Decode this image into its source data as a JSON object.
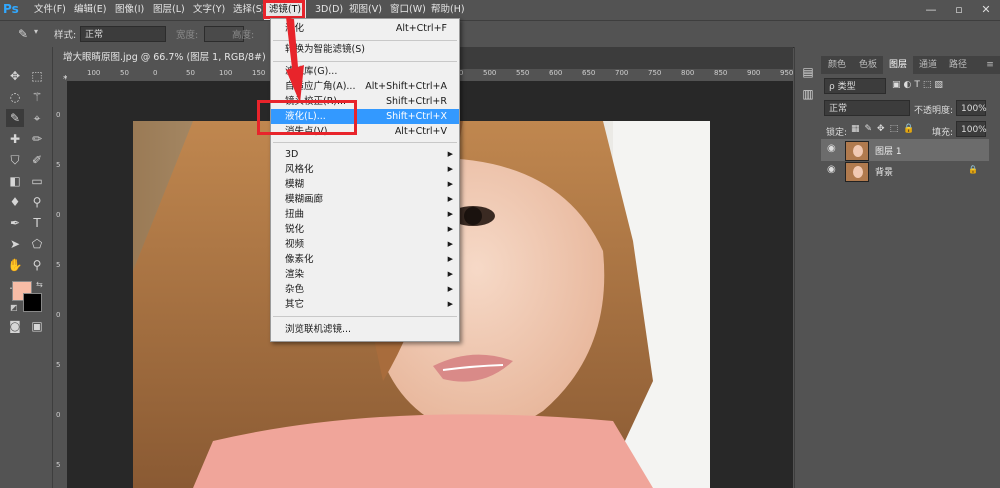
{
  "app": {
    "logo": "Ps"
  },
  "menubar": {
    "items": [
      "文件(F)",
      "编辑(E)",
      "图像(I)",
      "图层(L)",
      "文字(Y)",
      "选择(S)",
      "滤镜(T)",
      "3D(D)",
      "视图(V)",
      "窗口(W)",
      "帮助(H)"
    ],
    "window_controls": [
      "—",
      "▫",
      "✕"
    ]
  },
  "options": {
    "style_label": "样式:",
    "style_value": "正常",
    "width_label": "宽度:",
    "height_label": "高度:"
  },
  "document": {
    "tab_title": "增大眼睛原图.jpg @ 66.7% (图层 1, RGB/8#) *",
    "tab_close": "×",
    "ruler_top": [
      "100",
      "50",
      "0",
      "50",
      "100",
      "150",
      "200",
      "250",
      "300",
      "350",
      "400",
      "450",
      "500",
      "550",
      "600",
      "650",
      "700",
      "750",
      "800",
      "850",
      "900",
      "950"
    ],
    "ruler_left": [
      "0",
      "5",
      "0",
      "5",
      "0",
      "5",
      "0",
      "5"
    ]
  },
  "filter_menu": {
    "items": [
      {
        "label": "液化",
        "shortcut": "Alt+Ctrl+F"
      },
      {
        "label": "转换为智能滤镜(S)",
        "shortcut": ""
      },
      {
        "label": "滤镜库(G)...",
        "shortcut": ""
      },
      {
        "label": "自适应广角(A)...",
        "shortcut": "Alt+Shift+Ctrl+A"
      },
      {
        "label": "镜头校正(R)...",
        "shortcut": "Shift+Ctrl+R"
      },
      {
        "label": "液化(L)...",
        "shortcut": "Shift+Ctrl+X"
      },
      {
        "label": "消失点(V)...",
        "shortcut": "Alt+Ctrl+V"
      },
      {
        "label": "3D",
        "shortcut": ""
      },
      {
        "label": "风格化",
        "shortcut": ""
      },
      {
        "label": "模糊",
        "shortcut": ""
      },
      {
        "label": "模糊画廊",
        "shortcut": ""
      },
      {
        "label": "扭曲",
        "shortcut": ""
      },
      {
        "label": "锐化",
        "shortcut": ""
      },
      {
        "label": "视频",
        "shortcut": ""
      },
      {
        "label": "像素化",
        "shortcut": ""
      },
      {
        "label": "渲染",
        "shortcut": ""
      },
      {
        "label": "杂色",
        "shortcut": ""
      },
      {
        "label": "其它",
        "shortcut": ""
      },
      {
        "label": "浏览联机滤镜...",
        "shortcut": ""
      }
    ]
  },
  "panels": {
    "tabs": [
      "颜色",
      "色板",
      "图层",
      "通道",
      "路径"
    ],
    "kind_filter": "ρ 类型",
    "blend_mode": "正常",
    "opacity_label": "不透明度:",
    "opacity_value": "100%",
    "lock_label": "锁定:",
    "fill_label": "填充:",
    "fill_value": "100%",
    "layers": [
      {
        "name": "图层 1",
        "selected": true
      },
      {
        "name": "背景",
        "selected": false
      }
    ]
  },
  "colors": {
    "foreground": "#f7bca6",
    "background": "#000000",
    "highlight": "#3399ff",
    "annotation": "#e8242b"
  }
}
